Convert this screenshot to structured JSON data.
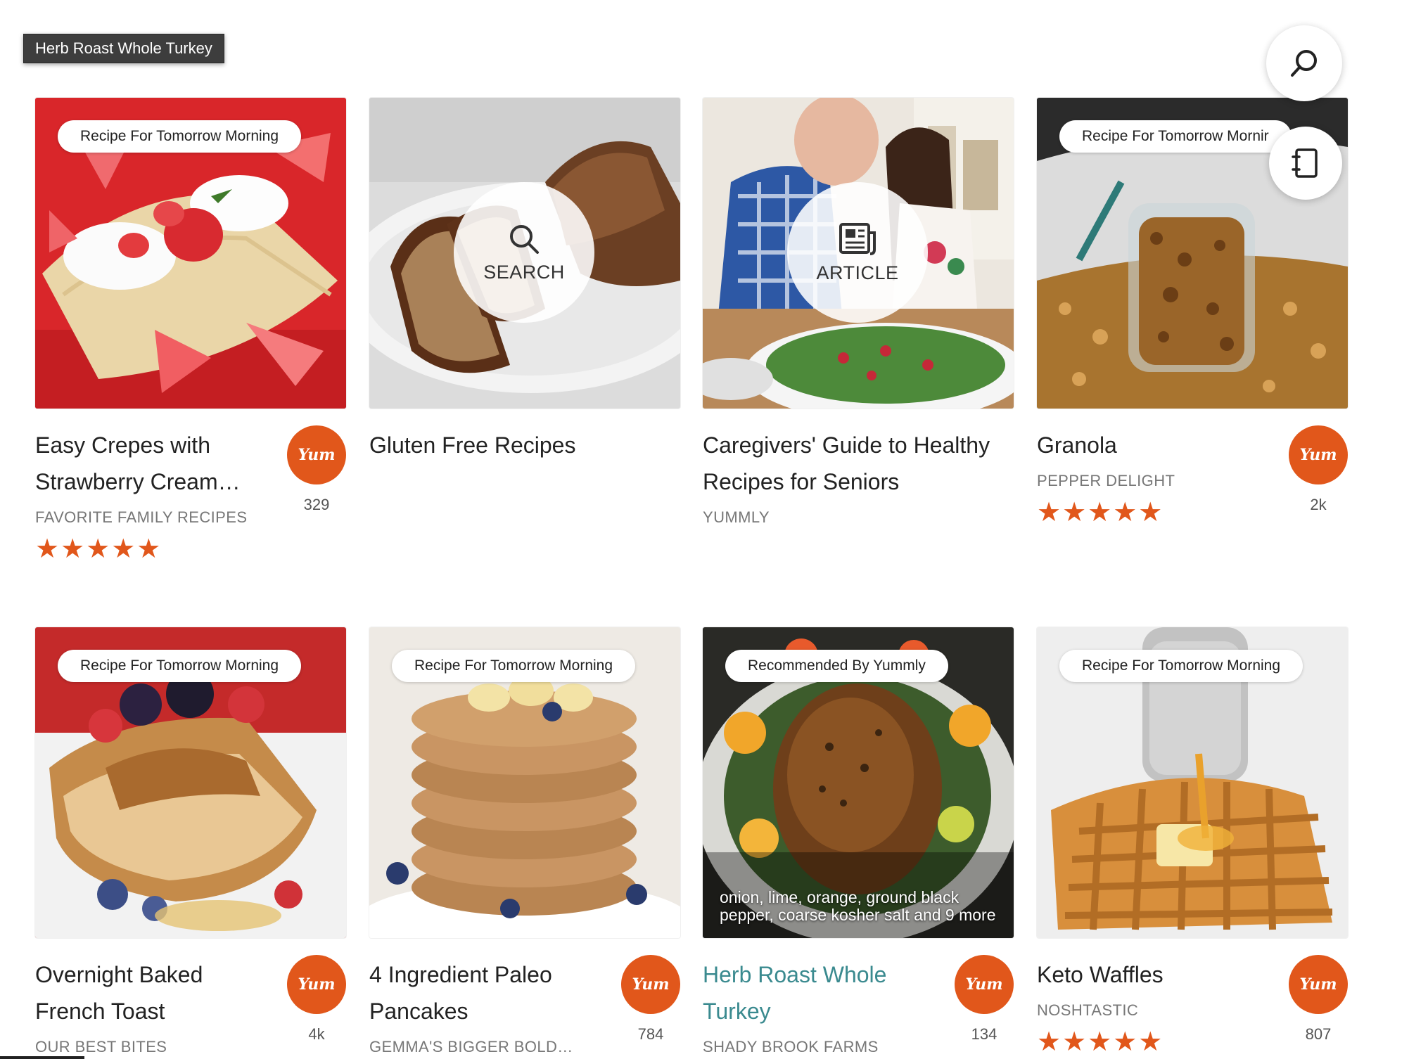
{
  "tooltip": "Herb Roast Whole Turkey",
  "colors": {
    "accent": "#e1571b",
    "link": "#3a8a8f"
  },
  "fabs": [
    {
      "name": "search-fab",
      "icon": "search-icon"
    },
    {
      "name": "collections-fab",
      "icon": "notebook-icon"
    }
  ],
  "cards": [
    {
      "title": "Easy Crepes with Strawberry Cream…",
      "tag": "Recipe For Tomorrow Morning",
      "source": "FAVORITE FAMILY RECIPES",
      "stars": "★★★★★",
      "yum_label": "Yum",
      "yum_count": "329"
    },
    {
      "title": "Gluten Free Recipes",
      "overlay": "SEARCH"
    },
    {
      "title": "Caregivers' Guide to Healthy Recipes for Seniors",
      "overlay": "ARTICLE",
      "source": "YUMMLY"
    },
    {
      "title": "Granola",
      "tag": "Recipe For Tomorrow Mornir",
      "source": "PEPPER DELIGHT",
      "stars": "★★★★★",
      "yum_label": "Yum",
      "yum_count": "2k"
    },
    {
      "title": "Overnight Baked French Toast",
      "tag": "Recipe For Tomorrow Morning",
      "source": "OUR BEST BITES",
      "yum_label": "Yum",
      "yum_count": "4k"
    },
    {
      "title": "4 Ingredient Paleo Pancakes",
      "tag": "Recipe For Tomorrow Morning",
      "source": "GEMMA'S BIGGER BOLD…",
      "yum_label": "Yum",
      "yum_count": "784"
    },
    {
      "title": "Herb Roast Whole Turkey",
      "tag": "Recommended By Yummly",
      "ingredients": "onion, lime, orange, ground black pepper, coarse kosher salt and 9 more",
      "source": "SHADY BROOK FARMS",
      "yum_label": "Yum",
      "yum_count": "134"
    },
    {
      "title": "Keto Waffles",
      "tag": "Recipe For Tomorrow Morning",
      "source": "NOSHTASTIC",
      "stars": "★★★★★",
      "yum_label": "Yum",
      "yum_count": "807"
    }
  ]
}
